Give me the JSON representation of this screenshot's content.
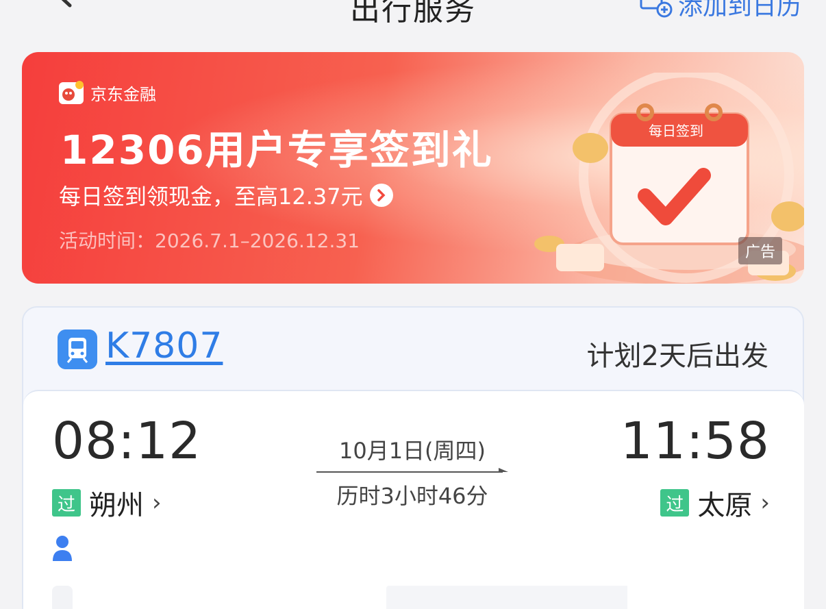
{
  "header": {
    "title": "出行服务",
    "add_to_calendar": "添加到日历"
  },
  "banner": {
    "brand": "京东金融",
    "title": "12306用户专享签到礼",
    "subtitle": "每日签到领现金，至高12.37元",
    "period": "活动时间：2026.7.1–2026.12.31",
    "ad_tag": "广告",
    "calendar_label": "每日签到"
  },
  "trip": {
    "train_number": "K7807",
    "departure_plan": "计划2天后出发",
    "depart_time": "08:12",
    "arrive_time": "11:58",
    "date": "10月1日(周四)",
    "duration": "历时3小时46分",
    "from_station": "朔州",
    "to_station": "太原",
    "pass_badge": "过"
  },
  "colors": {
    "accent": "#2f7de6",
    "banner_red": "#f53e3c",
    "pass_green": "#3fc58a"
  }
}
